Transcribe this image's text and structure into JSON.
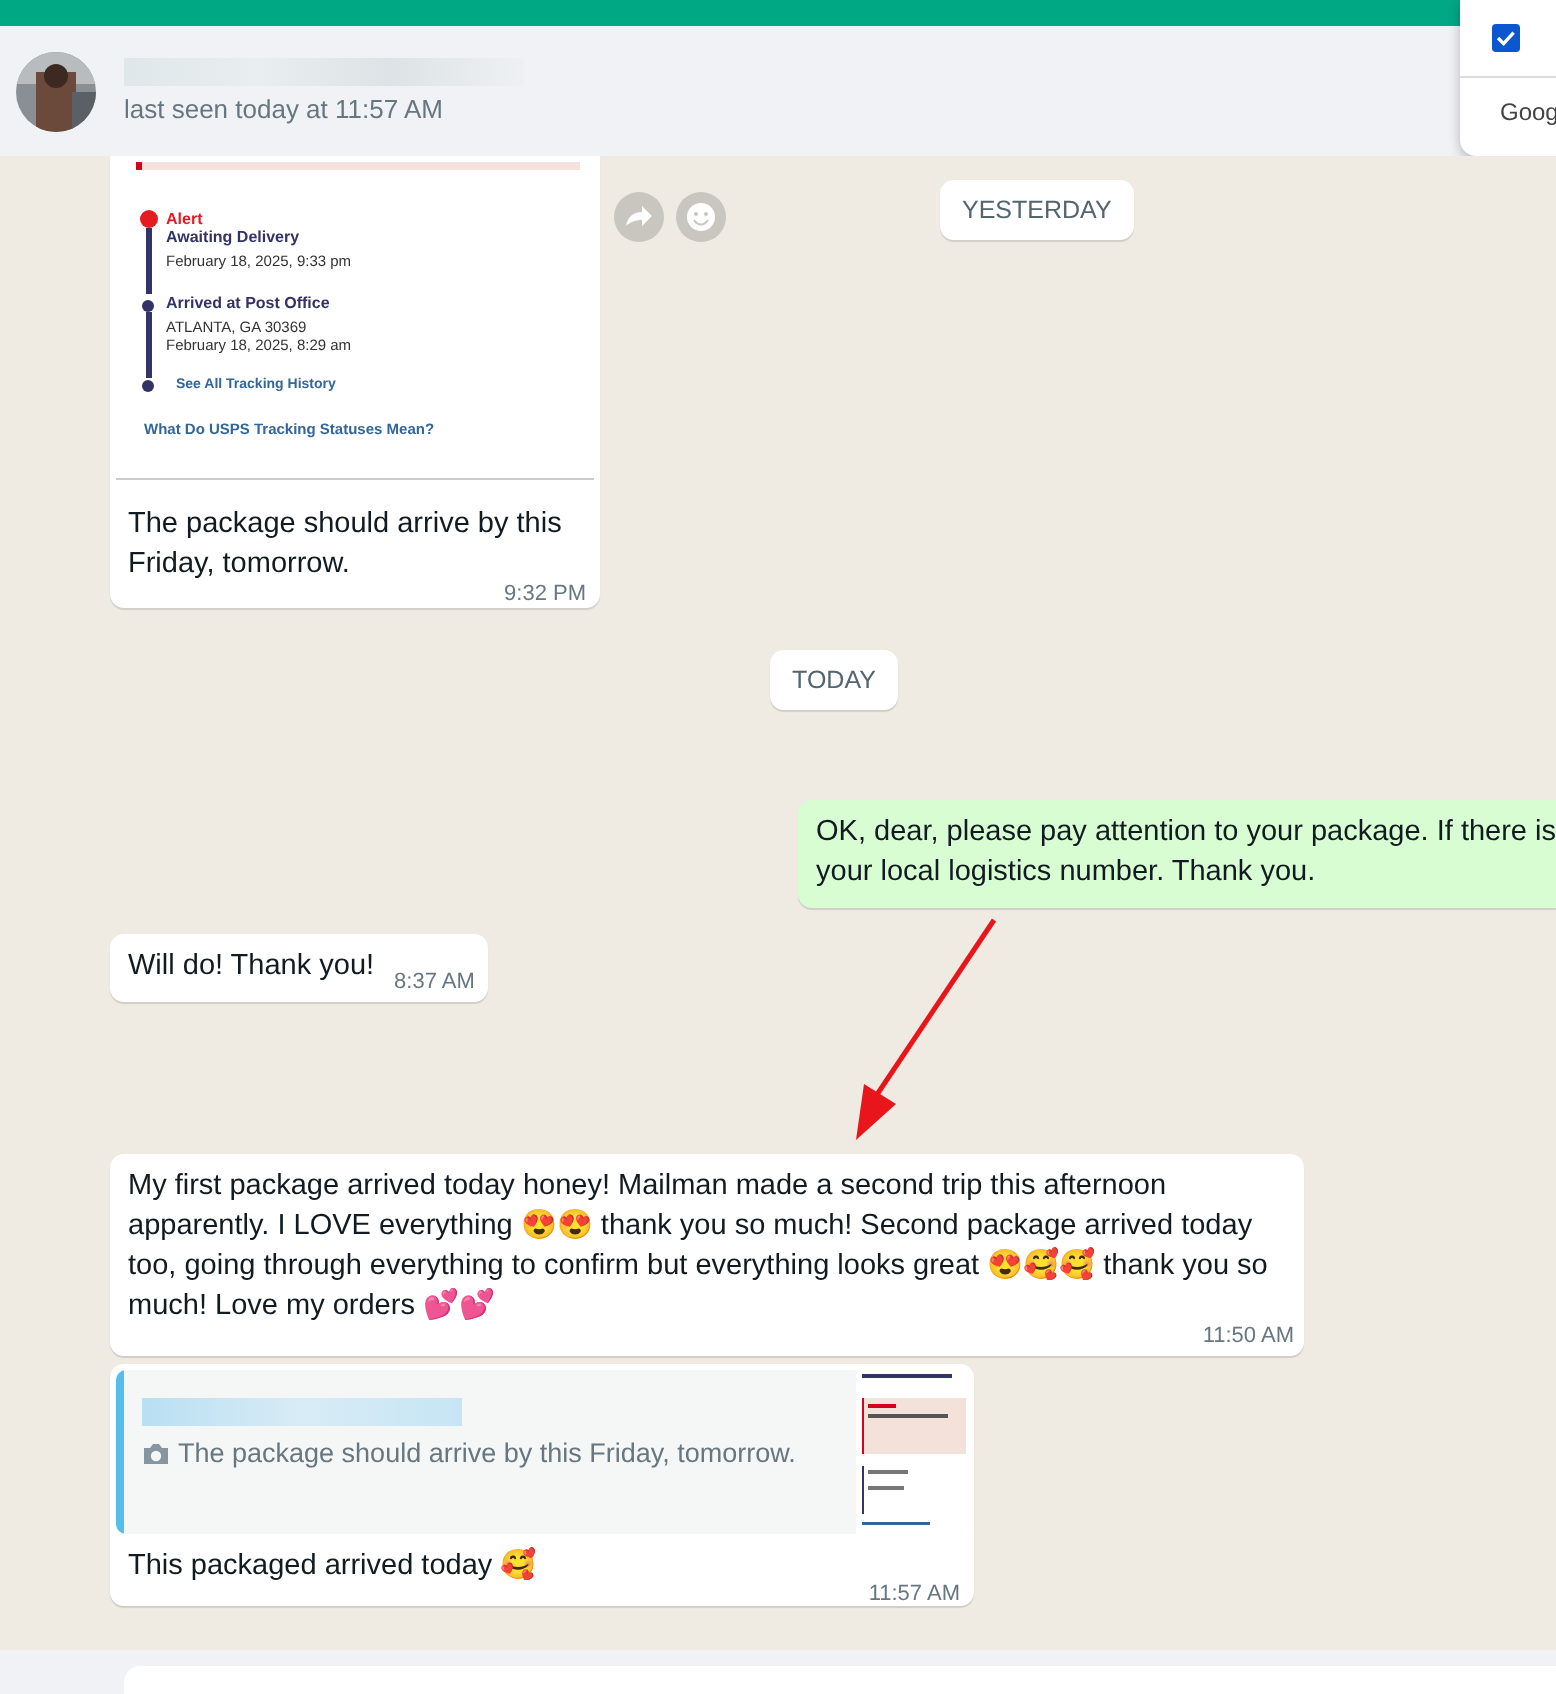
{
  "header": {
    "status": "last seen today at 11:57 AM"
  },
  "popup": {
    "checked": true,
    "label": "Goog"
  },
  "chat": {
    "messages": [
      {
        "tracking": {
          "events": [
            {
              "alert": "Alert",
              "title": "Awaiting Delivery",
              "lines": [
                "February 18, 2025, 9:33 pm"
              ],
              "current": true
            },
            {
              "title": "Arrived at Post Office",
              "lines": [
                "ATLANTA, GA 30369",
                "February 18, 2025, 8:29 am"
              ],
              "current": false
            }
          ],
          "history_link": "See All Tracking History",
          "statuses_link": "What Do USPS Tracking Statuses Mean?"
        },
        "text": "The package should arrive by this Friday, tomorrow.",
        "time": "9:32 PM"
      },
      {
        "kind": "date",
        "text": "YESTERDAY"
      },
      {
        "kind": "date",
        "text": "TODAY"
      },
      {
        "kind": "sent",
        "text_lines": [
          "OK, dear, please pay attention to your package. If there is",
          "your local logistics number. Thank you."
        ]
      },
      {
        "kind": "text",
        "text_lines": [
          "Will do! Thank you!"
        ],
        "time": "8:37 AM"
      },
      {
        "kind": "text",
        "text_lines": [
          "My first package arrived today honey! Mailman made a second trip this afternoon apparently. I LOVE everything 😍😍 thank you so much! Second package arrived today too, going through everything to confirm but everything looks great 😍🥰🥰 thank you so much! Love my orders 💕💕"
        ],
        "time": "11:50 AM"
      },
      {
        "kind": "reply",
        "quote": "The package should arrive by this Friday, tomorrow.",
        "text": "This packaged arrived today 🥰",
        "time": "11:57 AM"
      }
    ]
  }
}
